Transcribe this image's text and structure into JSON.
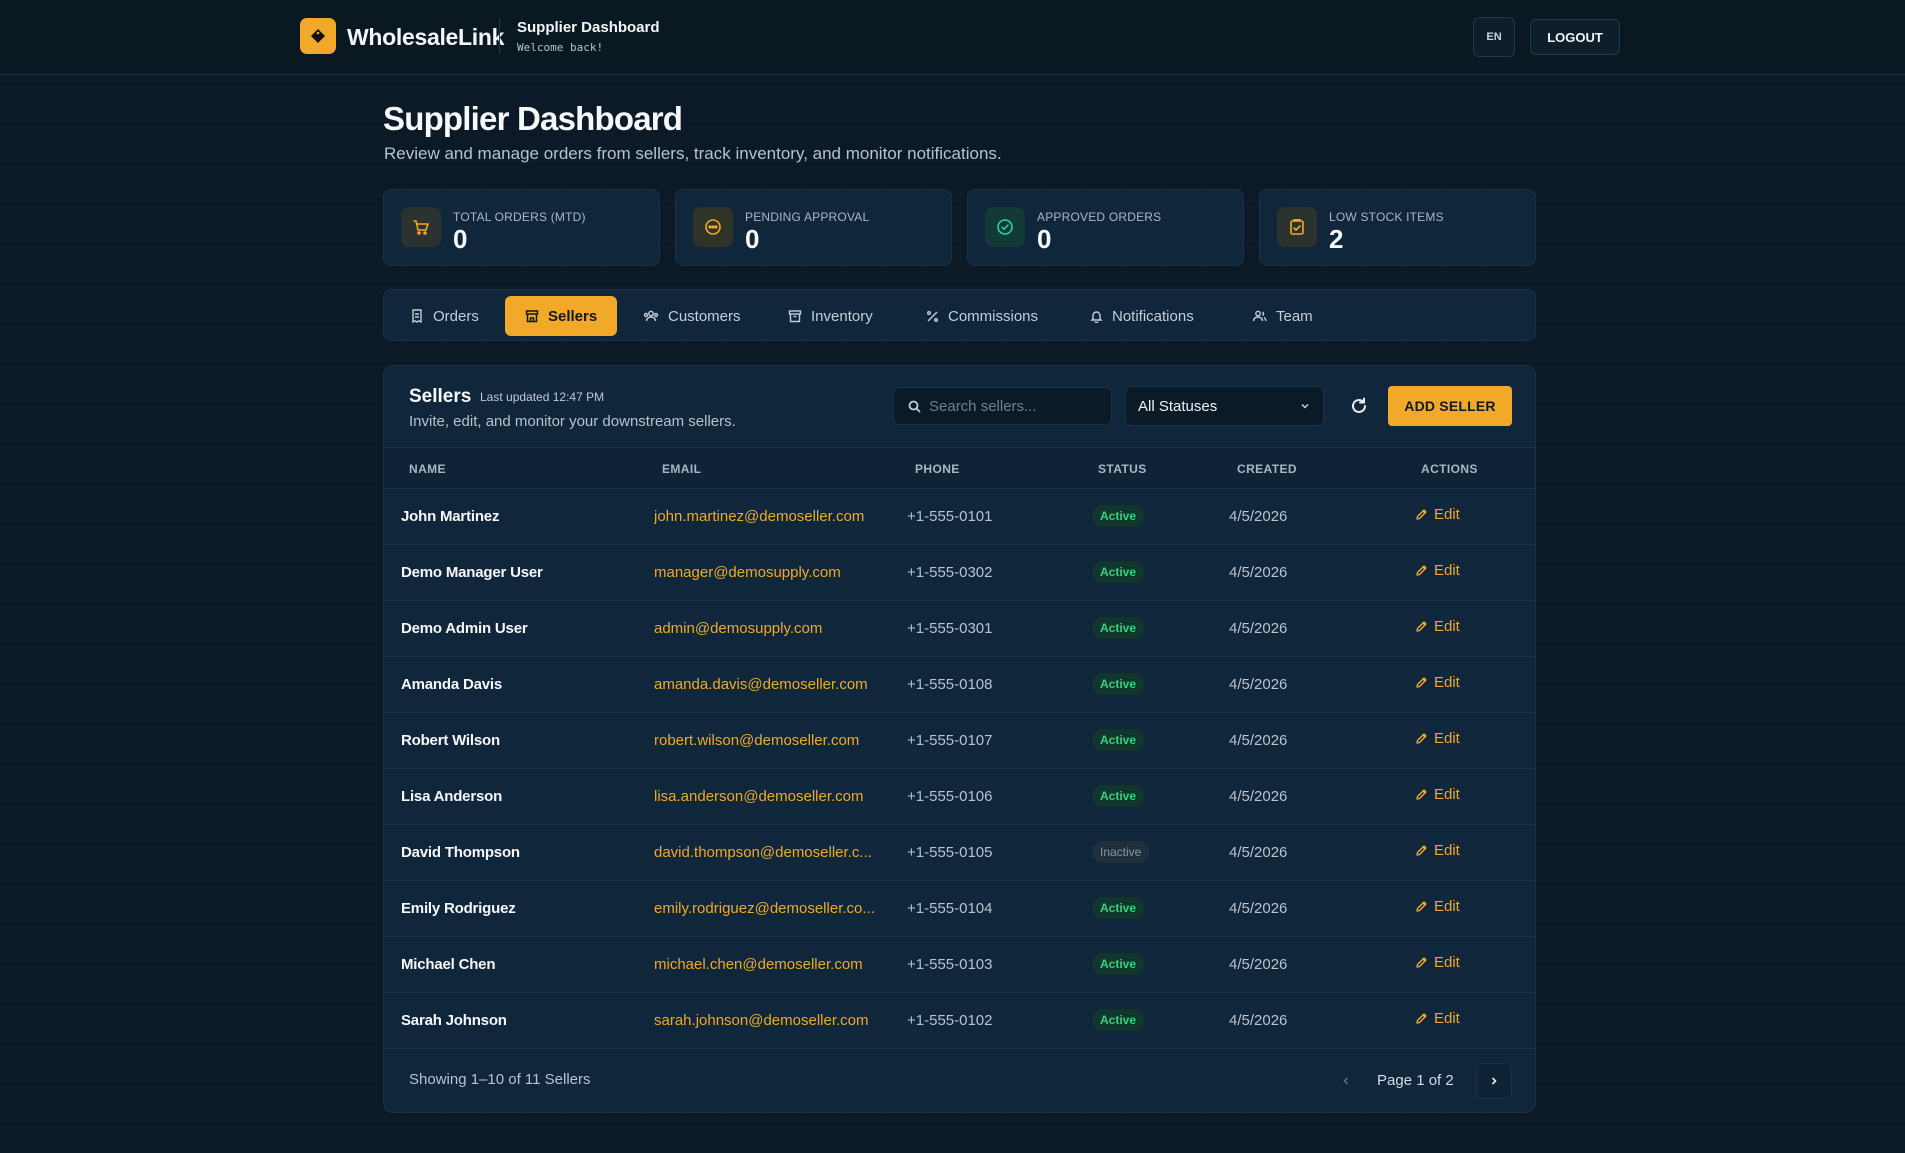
{
  "topbar": {
    "brand_name": "WholesaleLink",
    "title": "Supplier Dashboard",
    "subtitle": "Welcome back!",
    "lang": "EN",
    "logout": "LOGOUT"
  },
  "page": {
    "title": "Supplier Dashboard",
    "subtitle": "Review and manage orders from sellers, track inventory, and monitor notifications."
  },
  "stats": [
    {
      "label": "TOTAL ORDERS (MTD)",
      "value": "0",
      "icon": "cart-icon"
    },
    {
      "label": "PENDING APPROVAL",
      "value": "0",
      "icon": "clock-dots-icon"
    },
    {
      "label": "APPROVED ORDERS",
      "value": "0",
      "icon": "check-circle-icon"
    },
    {
      "label": "LOW STOCK ITEMS",
      "value": "2",
      "icon": "clipboard-alert-icon"
    }
  ],
  "tabs": [
    {
      "label": "Orders",
      "icon": "receipt-icon"
    },
    {
      "label": "Sellers",
      "icon": "store-icon",
      "active": true
    },
    {
      "label": "Customers",
      "icon": "users-icon"
    },
    {
      "label": "Inventory",
      "icon": "archive-icon"
    },
    {
      "label": "Commissions",
      "icon": "percent-icon"
    },
    {
      "label": "Notifications",
      "icon": "bell-icon"
    },
    {
      "label": "Team",
      "icon": "team-icon"
    }
  ],
  "panel": {
    "title": "Sellers",
    "updated": "Last updated 12:47 PM",
    "description": "Invite, edit, and monitor your downstream sellers.",
    "search_placeholder": "Search sellers...",
    "status_filter": "All Statuses",
    "add_button": "ADD SELLER"
  },
  "table": {
    "headers": {
      "name": "NAME",
      "email": "EMAIL",
      "phone": "PHONE",
      "status": "STATUS",
      "created": "CREATED",
      "actions": "ACTIONS"
    },
    "rows": [
      {
        "name": "John Martinez",
        "email": "john.martinez@demoseller.com",
        "phone": "+1-555-0101",
        "status": "Active",
        "created": "4/5/2026",
        "action": "Edit"
      },
      {
        "name": "Demo Manager User",
        "email": "manager@demosupply.com",
        "phone": "+1-555-0302",
        "status": "Active",
        "created": "4/5/2026",
        "action": "Edit"
      },
      {
        "name": "Demo Admin User",
        "email": "admin@demosupply.com",
        "phone": "+1-555-0301",
        "status": "Active",
        "created": "4/5/2026",
        "action": "Edit"
      },
      {
        "name": "Amanda Davis",
        "email": "amanda.davis@demoseller.com",
        "phone": "+1-555-0108",
        "status": "Active",
        "created": "4/5/2026",
        "action": "Edit"
      },
      {
        "name": "Robert Wilson",
        "email": "robert.wilson@demoseller.com",
        "phone": "+1-555-0107",
        "status": "Active",
        "created": "4/5/2026",
        "action": "Edit"
      },
      {
        "name": "Lisa Anderson",
        "email": "lisa.anderson@demoseller.com",
        "phone": "+1-555-0106",
        "status": "Active",
        "created": "4/5/2026",
        "action": "Edit"
      },
      {
        "name": "David Thompson",
        "email": "david.thompson@demoseller.c...",
        "phone": "+1-555-0105",
        "status": "Inactive",
        "created": "4/5/2026",
        "action": "Edit"
      },
      {
        "name": "Emily Rodriguez",
        "email": "emily.rodriguez@demoseller.co...",
        "phone": "+1-555-0104",
        "status": "Active",
        "created": "4/5/2026",
        "action": "Edit"
      },
      {
        "name": "Michael Chen",
        "email": "michael.chen@demoseller.com",
        "phone": "+1-555-0103",
        "status": "Active",
        "created": "4/5/2026",
        "action": "Edit"
      },
      {
        "name": "Sarah Johnson",
        "email": "sarah.johnson@demoseller.com",
        "phone": "+1-555-0102",
        "status": "Active",
        "created": "4/5/2026",
        "action": "Edit"
      }
    ]
  },
  "footer": {
    "showing": "Showing 1–10 of 11 Sellers",
    "page": "Page 1 of 2"
  },
  "colors": {
    "accent": "#f2a828",
    "background": "#0b1a26",
    "card": "#10263a",
    "active_status": "#34d17c"
  }
}
